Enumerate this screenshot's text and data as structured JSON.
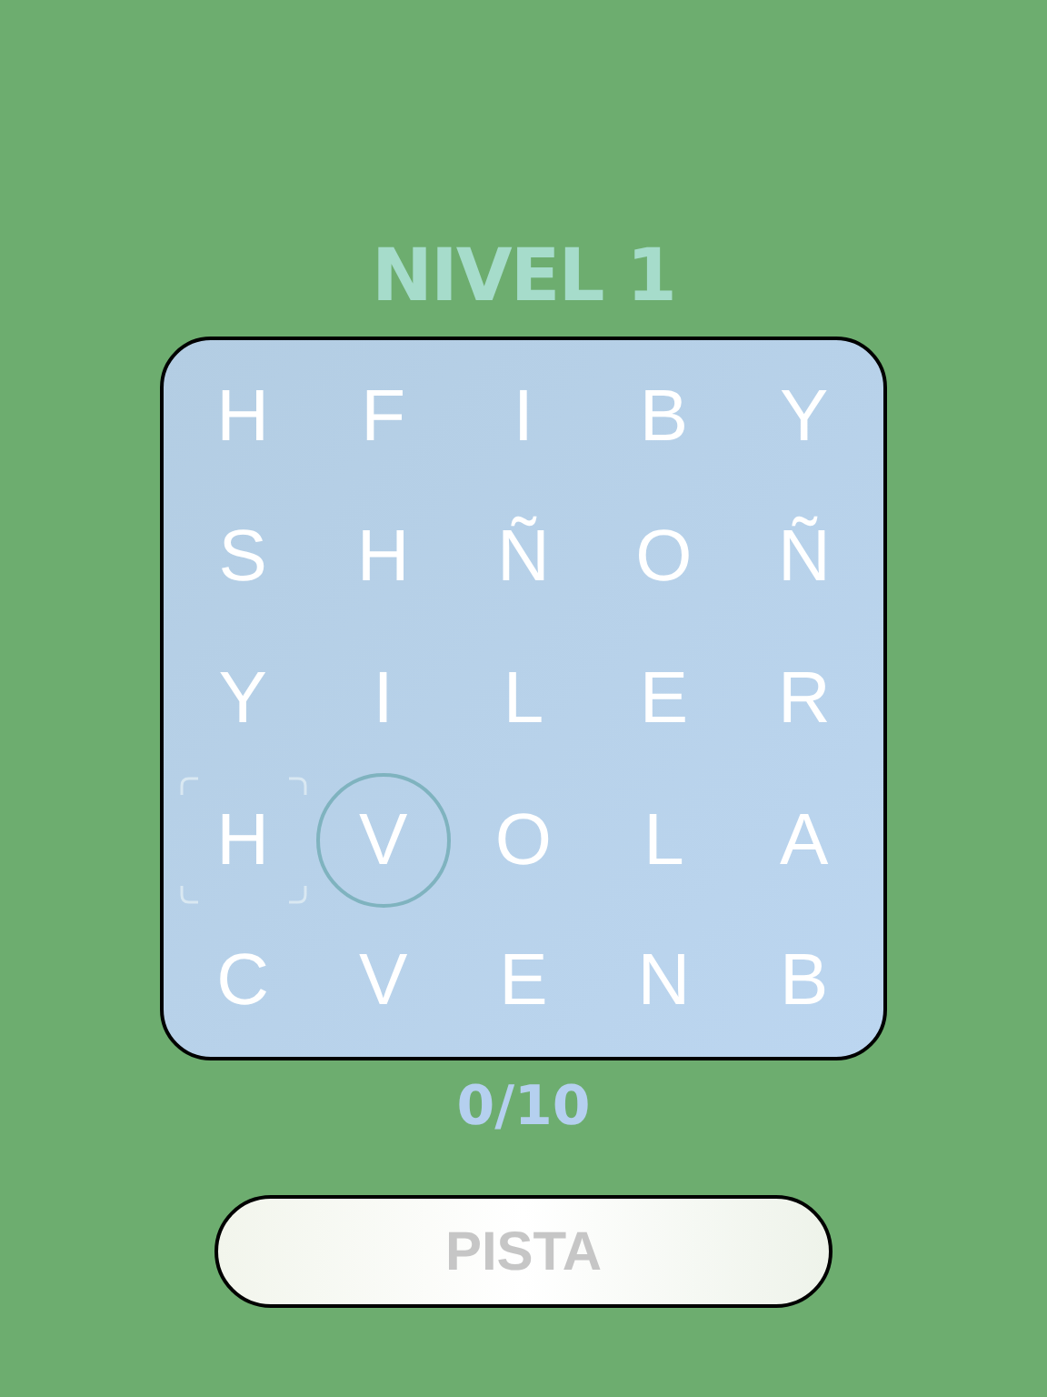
{
  "title": "NIVEL 1",
  "grid": [
    [
      {
        "letter": "H",
        "selected": false,
        "focused": false
      },
      {
        "letter": "F",
        "selected": false,
        "focused": false
      },
      {
        "letter": "I",
        "selected": false,
        "focused": false
      },
      {
        "letter": "B",
        "selected": false,
        "focused": false
      },
      {
        "letter": "Y",
        "selected": false,
        "focused": false
      }
    ],
    [
      {
        "letter": "S",
        "selected": false,
        "focused": false
      },
      {
        "letter": "H",
        "selected": false,
        "focused": false
      },
      {
        "letter": "Ñ",
        "selected": false,
        "focused": false
      },
      {
        "letter": "O",
        "selected": false,
        "focused": false
      },
      {
        "letter": "Ñ",
        "selected": false,
        "focused": false
      }
    ],
    [
      {
        "letter": "Y",
        "selected": false,
        "focused": false
      },
      {
        "letter": "I",
        "selected": false,
        "focused": false
      },
      {
        "letter": "L",
        "selected": false,
        "focused": false
      },
      {
        "letter": "E",
        "selected": false,
        "focused": false
      },
      {
        "letter": "R",
        "selected": false,
        "focused": false
      }
    ],
    [
      {
        "letter": "H",
        "selected": false,
        "focused": true
      },
      {
        "letter": "V",
        "selected": true,
        "focused": false
      },
      {
        "letter": "O",
        "selected": false,
        "focused": false
      },
      {
        "letter": "L",
        "selected": false,
        "focused": false
      },
      {
        "letter": "A",
        "selected": false,
        "focused": false
      }
    ],
    [
      {
        "letter": "C",
        "selected": false,
        "focused": false
      },
      {
        "letter": "V",
        "selected": false,
        "focused": false
      },
      {
        "letter": "E",
        "selected": false,
        "focused": false
      },
      {
        "letter": "N",
        "selected": false,
        "focused": false
      },
      {
        "letter": "B",
        "selected": false,
        "focused": false
      }
    ]
  ],
  "progress": "0/10",
  "hint_button": {
    "label": "PISTA"
  }
}
